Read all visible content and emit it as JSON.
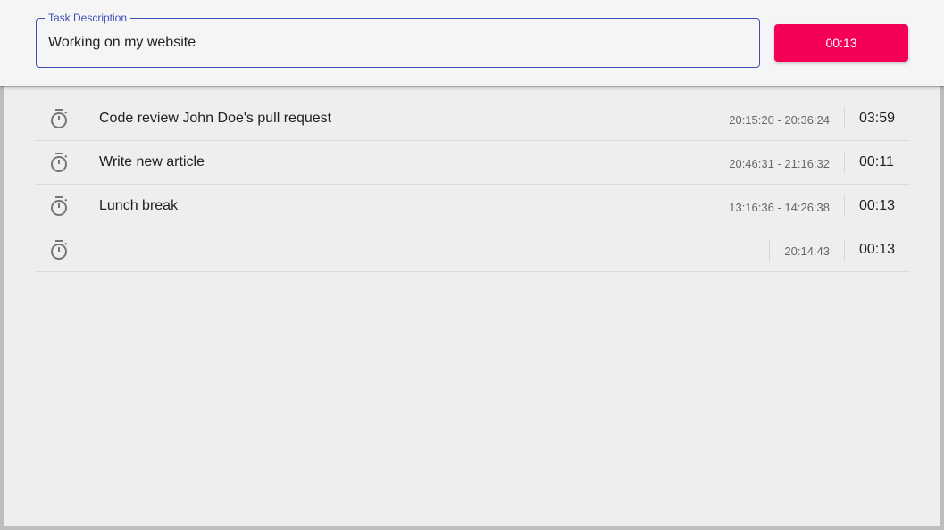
{
  "header": {
    "field_label": "Task Description",
    "field_value": "Working on my website",
    "timer_label": "00:13"
  },
  "accent_colors": {
    "field_outline": "#3f51b5",
    "timer_button": "#f50057"
  },
  "entries": [
    {
      "icon": "stopwatch-icon",
      "description": "Code review John Doe's pull request",
      "range": "20:15:20 - 20:36:24",
      "duration": "03:59"
    },
    {
      "icon": "stopwatch-icon",
      "description": "Write new article",
      "range": "20:46:31 - 21:16:32",
      "duration": "00:11"
    },
    {
      "icon": "stopwatch-icon",
      "description": "Lunch break",
      "range": "13:16:36 - 14:26:38",
      "duration": "00:13"
    },
    {
      "icon": "stopwatch-icon",
      "description": "",
      "range": "20:14:43",
      "duration": "00:13"
    }
  ]
}
